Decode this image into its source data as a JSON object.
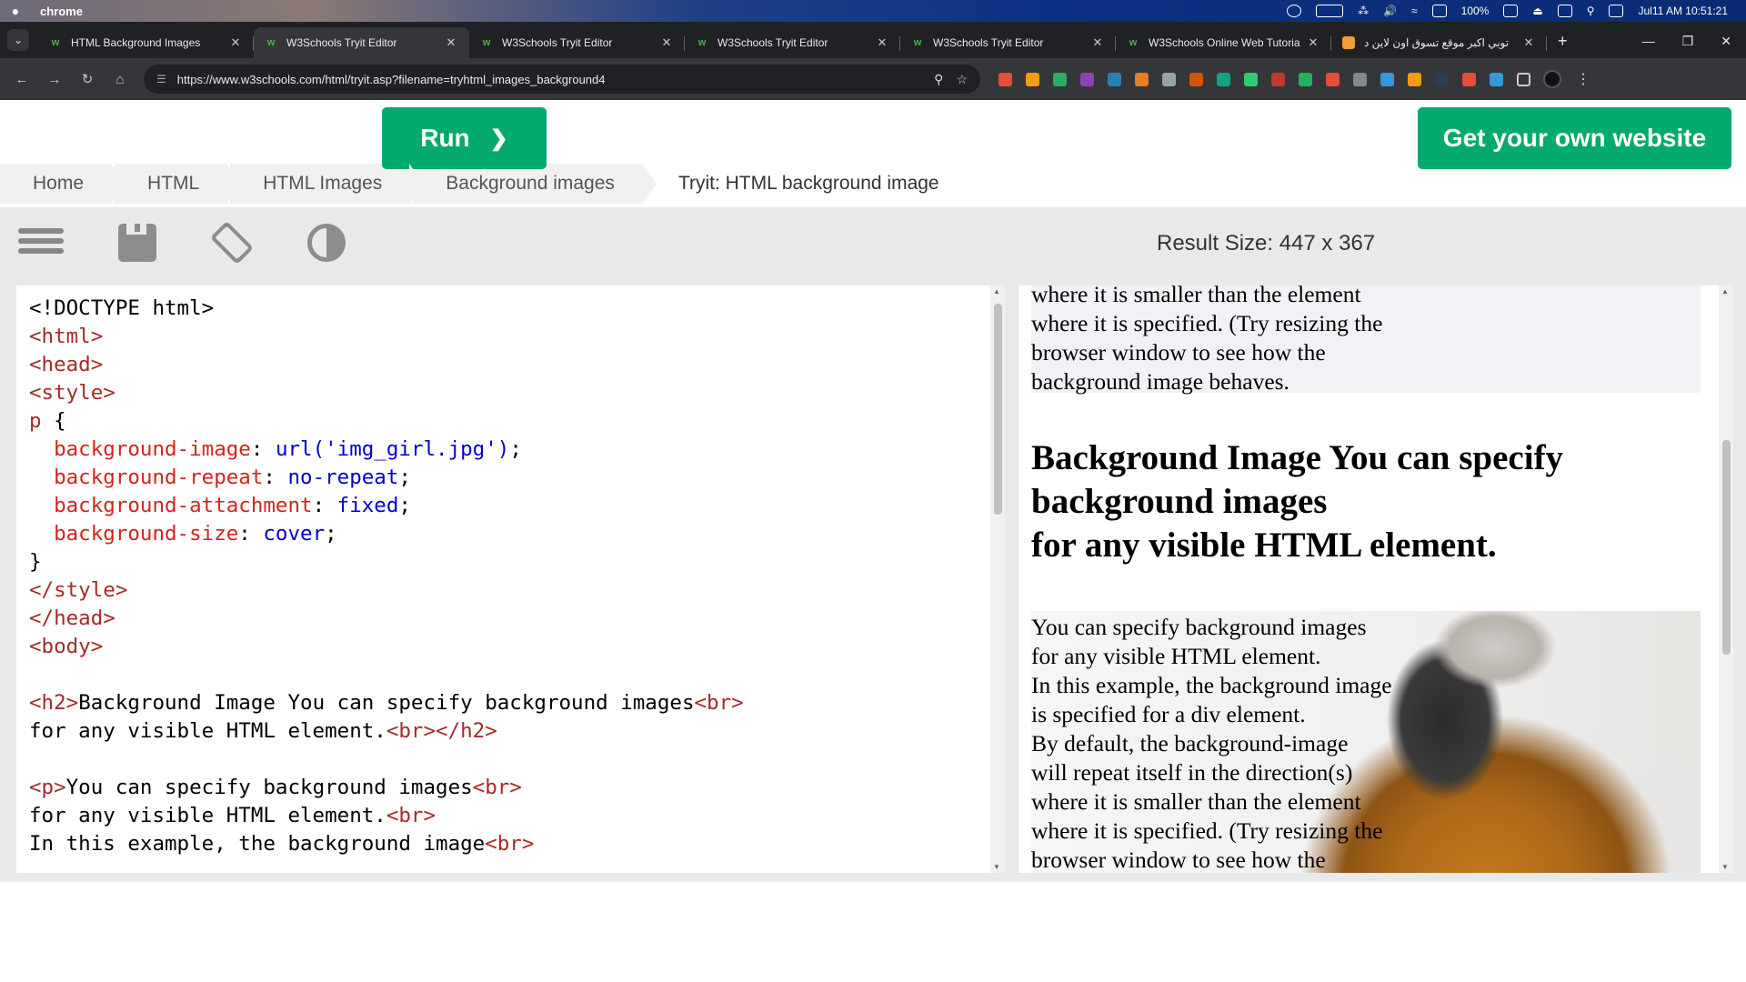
{
  "menubar": {
    "app_name": "chrome",
    "battery": "100%",
    "clock": "Jul11 AM 10:51:21"
  },
  "tabs": [
    {
      "label": "HTML Background Images",
      "active": false
    },
    {
      "label": "W3Schools Tryit Editor",
      "active": true
    },
    {
      "label": "W3Schools Tryit Editor",
      "active": false
    },
    {
      "label": "W3Schools Tryit Editor",
      "active": false
    },
    {
      "label": "W3Schools Tryit Editor",
      "active": false
    },
    {
      "label": "W3Schools Online Web Tutoria",
      "active": false
    },
    {
      "label": "توبي اكبر موقع تسوق اون لاين د",
      "active": false
    }
  ],
  "toolbar": {
    "url": "https://www.w3schools.com/html/tryit.asp?filename=tryhtml_images_background4"
  },
  "breadcrumb": [
    "Home",
    "HTML",
    "HTML Images",
    "Background images",
    "Tryit: HTML background image"
  ],
  "editor": {
    "run_label": "Run",
    "run_chevron": "❯",
    "result_size": "Result Size: 447 x 367",
    "own_website_label": "Get your own website"
  },
  "code_lines": [
    [
      {
        "t": "<!DOCTYPE html>",
        "c": "txt"
      }
    ],
    [
      {
        "t": "<html>",
        "c": "tag"
      }
    ],
    [
      {
        "t": "<head>",
        "c": "tag"
      }
    ],
    [
      {
        "t": "<style>",
        "c": "tag"
      }
    ],
    [
      {
        "t": "p",
        "c": "sel"
      },
      {
        "t": " {",
        "c": "txt"
      }
    ],
    [
      {
        "t": "  background-image",
        "c": "prop"
      },
      {
        "t": ": ",
        "c": "txt"
      },
      {
        "t": "url('img_girl.jpg')",
        "c": "val"
      },
      {
        "t": ";",
        "c": "txt"
      }
    ],
    [
      {
        "t": "  background-repeat",
        "c": "prop"
      },
      {
        "t": ": ",
        "c": "txt"
      },
      {
        "t": "no-repeat",
        "c": "val"
      },
      {
        "t": ";",
        "c": "txt"
      }
    ],
    [
      {
        "t": "  background-attachment",
        "c": "prop"
      },
      {
        "t": ": ",
        "c": "txt"
      },
      {
        "t": "fixed",
        "c": "val"
      },
      {
        "t": ";",
        "c": "txt"
      }
    ],
    [
      {
        "t": "  background-size",
        "c": "prop"
      },
      {
        "t": ": ",
        "c": "txt"
      },
      {
        "t": "cover",
        "c": "val"
      },
      {
        "t": ";",
        "c": "txt"
      }
    ],
    [
      {
        "t": "}",
        "c": "txt"
      }
    ],
    [
      {
        "t": "</style>",
        "c": "tag"
      }
    ],
    [
      {
        "t": "</head>",
        "c": "tag"
      }
    ],
    [
      {
        "t": "<body>",
        "c": "tag"
      }
    ],
    [
      {
        "t": "",
        "c": "txt"
      }
    ],
    [
      {
        "t": "<h2>",
        "c": "tag"
      },
      {
        "t": "Background Image You can specify background images",
        "c": "txt"
      },
      {
        "t": "<br>",
        "c": "tag"
      }
    ],
    [
      {
        "t": "for any visible HTML element.",
        "c": "txt"
      },
      {
        "t": "<br></h2>",
        "c": "tag"
      }
    ],
    [
      {
        "t": "",
        "c": "txt"
      }
    ],
    [
      {
        "t": "<p>",
        "c": "tag"
      },
      {
        "t": "You can specify background images",
        "c": "txt"
      },
      {
        "t": "<br>",
        "c": "tag"
      }
    ],
    [
      {
        "t": "for any visible HTML element.",
        "c": "txt"
      },
      {
        "t": "<br>",
        "c": "tag"
      }
    ],
    [
      {
        "t": "In this example, the background image",
        "c": "txt"
      },
      {
        "t": "<br>",
        "c": "tag"
      }
    ]
  ],
  "result": {
    "p1_lines": [
      "where it is smaller than the element",
      "where it is specified. (Try resizing the",
      "browser window to see how the",
      "background image behaves."
    ],
    "h2_lines": [
      "Background Image You can specify",
      "background images",
      "for any visible HTML element."
    ],
    "p2_lines": [
      "You can specify background images",
      "for any visible HTML element.",
      "In this example, the background image",
      "is specified for a div element.",
      "By default, the background-image",
      "will repeat itself in the direction(s)",
      "where it is smaller than the element",
      "where it is specified. (Try resizing the",
      "browser window to see how the"
    ]
  },
  "colors": {
    "run_green": "#04aa6d",
    "editor_bar": "#e7e9eb",
    "code_tag": "#a52a2a",
    "code_property": "#d2241f",
    "code_value": "#0000cd"
  }
}
